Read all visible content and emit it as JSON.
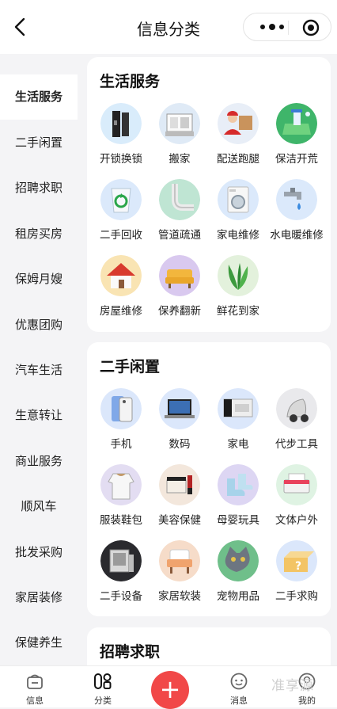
{
  "header": {
    "title": "信息分类"
  },
  "sidebar": {
    "items": [
      {
        "label": "生活服务",
        "active": true
      },
      {
        "label": "二手闲置"
      },
      {
        "label": "招聘求职"
      },
      {
        "label": "租房买房"
      },
      {
        "label": "保姆月嫂"
      },
      {
        "label": "优惠团购"
      },
      {
        "label": "汽车生活"
      },
      {
        "label": "生意转让"
      },
      {
        "label": "商业服务"
      },
      {
        "label": "顺风车"
      },
      {
        "label": "批发采购"
      },
      {
        "label": "家居装修"
      },
      {
        "label": "保健养生"
      }
    ]
  },
  "sections": [
    {
      "title": "生活服务",
      "items": [
        {
          "label": "开锁换锁",
          "icon": "lock-icon"
        },
        {
          "label": "搬家",
          "icon": "moving-icon"
        },
        {
          "label": "配送跑腿",
          "icon": "delivery-icon"
        },
        {
          "label": "保洁开荒",
          "icon": "cleaning-icon"
        },
        {
          "label": "二手回收",
          "icon": "recycle-icon"
        },
        {
          "label": "管道疏通",
          "icon": "pipe-icon"
        },
        {
          "label": "家电维修",
          "icon": "washing-machine-icon"
        },
        {
          "label": "水电暖维修",
          "icon": "faucet-icon"
        },
        {
          "label": "房屋维修",
          "icon": "house-icon"
        },
        {
          "label": "保养翻新",
          "icon": "sofa-icon"
        },
        {
          "label": "鲜花到家",
          "icon": "plant-icon"
        }
      ]
    },
    {
      "title": "二手闲置",
      "items": [
        {
          "label": "手机",
          "icon": "phone-icon"
        },
        {
          "label": "数码",
          "icon": "laptop-icon"
        },
        {
          "label": "家电",
          "icon": "appliance-icon"
        },
        {
          "label": "代步工具",
          "icon": "scooter-icon"
        },
        {
          "label": "服装鞋包",
          "icon": "clothing-icon"
        },
        {
          "label": "美容保健",
          "icon": "cosmetics-icon"
        },
        {
          "label": "母婴玩具",
          "icon": "baby-shoes-icon"
        },
        {
          "label": "文体户外",
          "icon": "printer-icon"
        },
        {
          "label": "二手设备",
          "icon": "equipment-icon"
        },
        {
          "label": "家居软装",
          "icon": "armchair-icon"
        },
        {
          "label": "宠物用品",
          "icon": "cat-icon"
        },
        {
          "label": "二手求购",
          "icon": "question-box-icon"
        }
      ]
    },
    {
      "title": "招聘求职",
      "items": []
    }
  ],
  "tabbar": {
    "tabs": [
      {
        "label": "信息",
        "icon": "info-icon"
      },
      {
        "label": "分类",
        "icon": "category-icon"
      },
      {
        "label": "",
        "icon": "plus-icon"
      },
      {
        "label": "消息",
        "icon": "message-icon"
      },
      {
        "label": "我的",
        "icon": "profile-icon"
      }
    ],
    "plus_symbol": "+",
    "watermark": "准享源"
  },
  "colors": {
    "accent": "#f14848",
    "background": "#f4f4f6",
    "card": "#ffffff"
  }
}
